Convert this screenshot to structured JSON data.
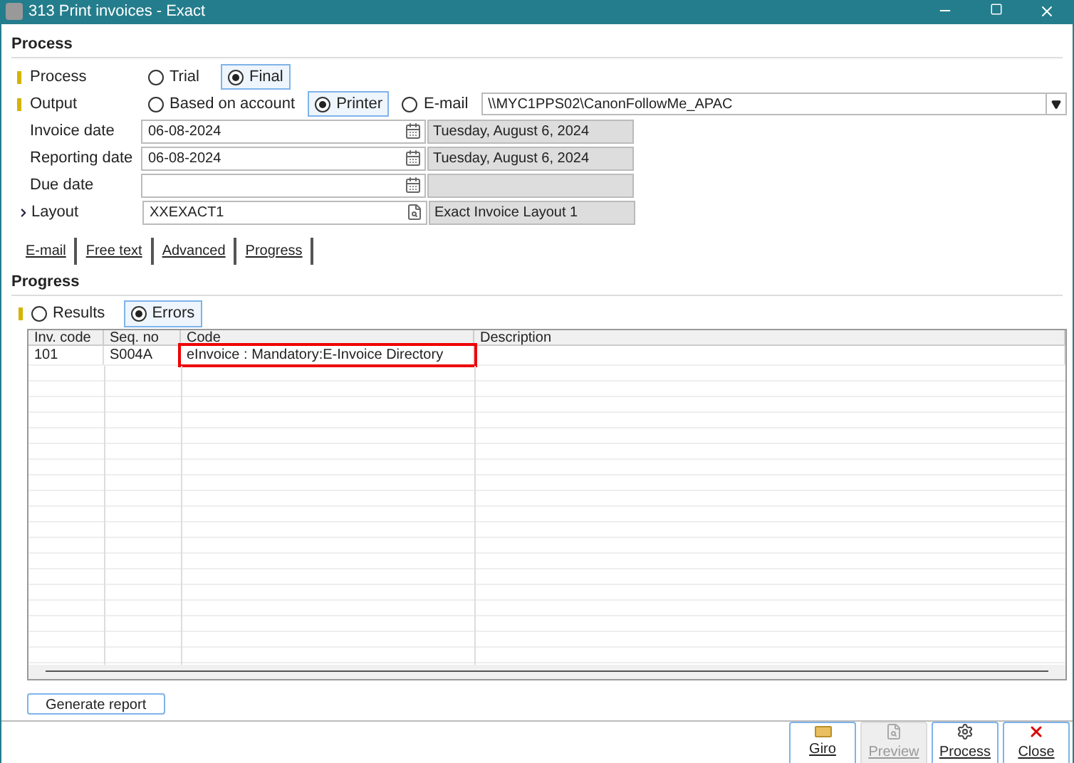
{
  "window": {
    "title": "313 Print invoices - Exact"
  },
  "process_section": {
    "title": "Process"
  },
  "process": {
    "label": "Process",
    "required": true,
    "options": [
      {
        "label": "Trial",
        "selected": false
      },
      {
        "label": "Final",
        "selected": true
      }
    ]
  },
  "output": {
    "label": "Output",
    "required": true,
    "options": [
      {
        "label": "Based on account",
        "selected": false
      },
      {
        "label": "Printer",
        "selected": true
      },
      {
        "label": "E-mail",
        "selected": false
      }
    ],
    "printer": "\\\\MYC1PPS02\\CanonFollowMe_APAC"
  },
  "fields": [
    {
      "label": "Invoice date",
      "value": "06-08-2024",
      "kind": "date",
      "description": "Tuesday, August 6, 2024"
    },
    {
      "label": "Reporting date",
      "value": "06-08-2024",
      "kind": "date",
      "description": "Tuesday, August 6, 2024"
    },
    {
      "label": "Due date",
      "kind": "date"
    },
    {
      "label": "Layout",
      "value": "XXEXACT1",
      "kind": "lookup",
      "description": "Exact Invoice Layout 1",
      "expandable": true
    }
  ],
  "tabs": [
    {
      "label": "E-mail"
    },
    {
      "label": "Free text"
    },
    {
      "label": "Advanced"
    },
    {
      "label": "Progress"
    }
  ],
  "progress_section": {
    "title": "Progress"
  },
  "view": {
    "required": true,
    "options": [
      {
        "label": "Results",
        "selected": false
      },
      {
        "label": "Errors",
        "selected": true
      }
    ]
  },
  "table": {
    "columns": [
      "Inv. code",
      "Seq. no",
      "Code",
      "Description"
    ],
    "rows": [
      {
        "cells": [
          "101",
          "S004A",
          "eInvoice : Mandatory:E-Invoice Directory",
          ""
        ],
        "highlighted": true
      }
    ]
  },
  "generate_button": "Generate report",
  "buttons": [
    {
      "label": "Giro",
      "kind": "giro",
      "disabled": false
    },
    {
      "label": "Preview",
      "kind": "preview",
      "disabled": true
    },
    {
      "label": "Process",
      "kind": "process",
      "disabled": false
    },
    {
      "label": "Close",
      "kind": "close",
      "disabled": false
    }
  ]
}
